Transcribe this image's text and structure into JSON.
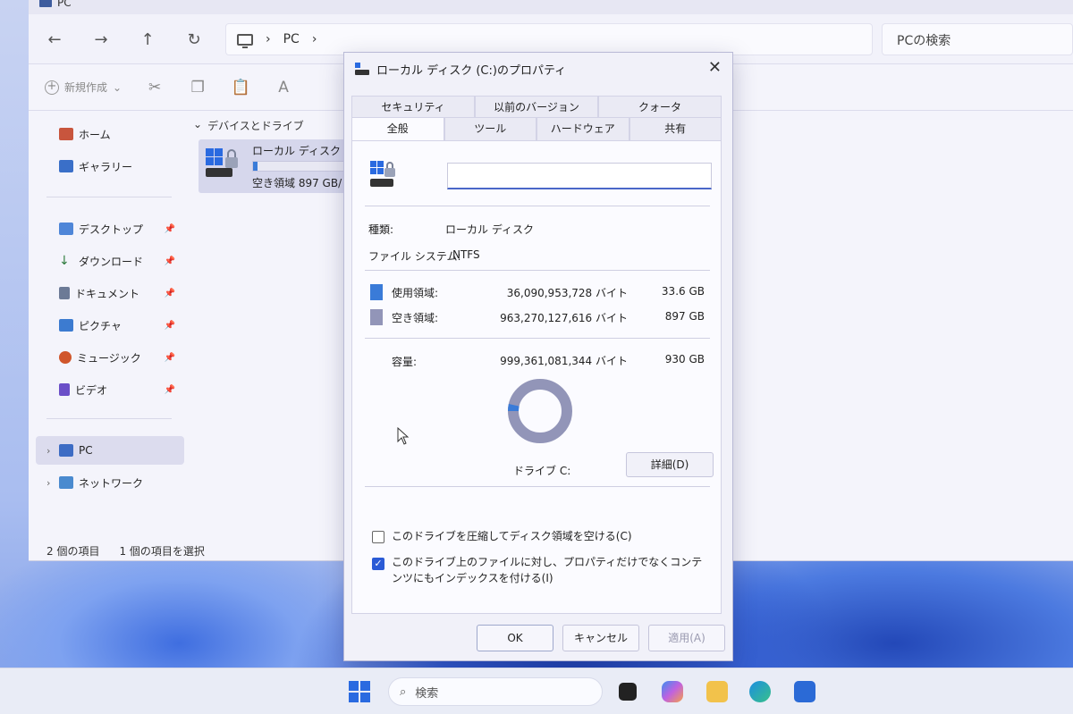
{
  "explorer": {
    "tab_title": "PC",
    "address": "PC",
    "search_placeholder": "PCの検索",
    "toolbar_new": "新規作成",
    "section_header": "デバイスとドライブ",
    "drive_name": "ローカル ディスク (C:",
    "drive_free": "空き領域 897 GB/",
    "drive_usage_fraction": 0.036,
    "status_items": "2 個の項目",
    "status_selected": "1 個の項目を選択",
    "sidebar": {
      "home": "ホーム",
      "gallery": "ギャラリー",
      "desktop": "デスクトップ",
      "downloads": "ダウンロード",
      "documents": "ドキュメント",
      "pictures": "ピクチャ",
      "music": "ミュージック",
      "videos": "ビデオ",
      "pc": "PC",
      "network": "ネットワーク"
    }
  },
  "dialog": {
    "title": "ローカル ディスク (C:)のプロパティ",
    "tabs_top": [
      "セキュリティ",
      "以前のバージョン",
      "クォータ"
    ],
    "tabs_bottom": [
      "全般",
      "ツール",
      "ハードウェア",
      "共有"
    ],
    "active_tab": "全般",
    "name_value": "",
    "type_label": "種類:",
    "type_value": "ローカル ディスク",
    "fs_label": "ファイル システム:",
    "fs_value": "NTFS",
    "used_label": "使用領域:",
    "used_bytes": "36,090,953,728 バイト",
    "used_gb": "33.6 GB",
    "free_label": "空き領域:",
    "free_bytes": "963,270,127,616 バイト",
    "free_gb": "897 GB",
    "capacity_label": "容量:",
    "capacity_bytes": "999,361,081,344 バイト",
    "capacity_gb": "930 GB",
    "used_fraction": 0.036,
    "drive_label": "ドライブ C:",
    "details_button": "詳細(D)",
    "compress_label": "このドライブを圧縮してディスク領域を空ける(C)",
    "compress_checked": false,
    "index_label": "このドライブ上のファイルに対し、プロパティだけでなくコンテンツにもインデックスを付ける(I)",
    "index_checked": true,
    "ok": "OK",
    "cancel": "キャンセル",
    "apply": "適用(A)",
    "colors": {
      "used": "#3a7bd8",
      "free": "#9295b8"
    }
  },
  "taskbar": {
    "search_placeholder": "検索"
  }
}
